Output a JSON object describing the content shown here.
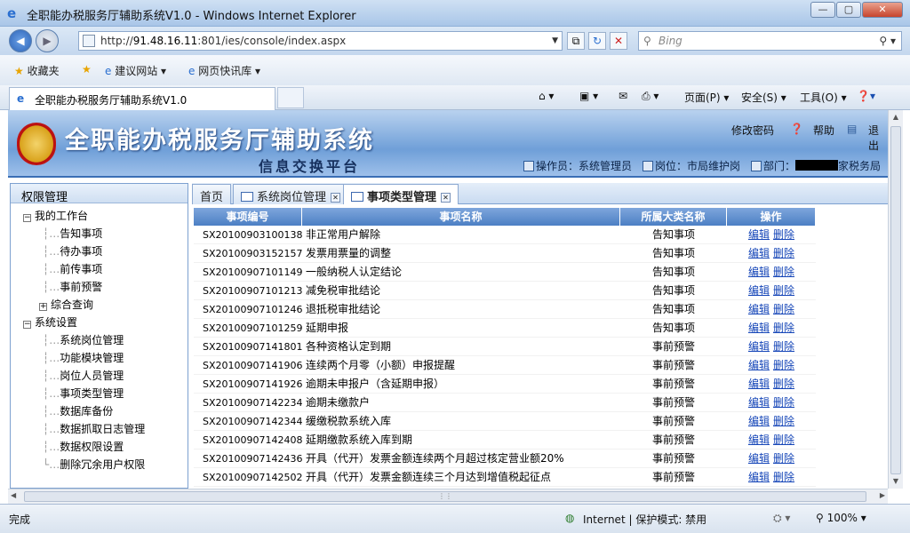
{
  "window": {
    "title": "全职能办税服务厅辅助系统V1.0 - Windows Internet Explorer",
    "controls": [
      "—",
      "▢",
      "✕"
    ]
  },
  "browser": {
    "address": {
      "prefix": "http://",
      "host": "91.48.16.11",
      "rest": ":801/ies/console/index.aspx"
    },
    "search_placeholder": "Bing",
    "favorites_label": "收藏夹",
    "fav_links": [
      "建议网站 ▾",
      "网页快讯库 ▾"
    ],
    "tab_title": "全职能办税服务厅辅助系统V1.0",
    "commands": [
      "页面(P) ▾",
      "安全(S) ▾",
      "工具(O) ▾"
    ],
    "status_left": "完成",
    "status_zone": "Internet | 保护模式: 禁用",
    "zoom": "100%"
  },
  "app": {
    "title": "全职能办税服务厅辅助系统",
    "subtitle": "信息交换平台",
    "top_links": {
      "change_password": "修改密码",
      "help": "帮助",
      "logout": "退出"
    },
    "user": {
      "operator": "操作员：系统管理员",
      "position": "岗位：市局维护岗",
      "dept_prefix": "部门：",
      "dept_suffix": "家税务局"
    }
  },
  "sidebar": {
    "header": "权限管理",
    "groups": [
      {
        "label": "我的工作台",
        "toggle": "−",
        "items": [
          "告知事项",
          "待办事项",
          "前传事项",
          "事前预警"
        ],
        "sub": {
          "label": "综合查询",
          "toggle": "+"
        }
      },
      {
        "label": "系统设置",
        "toggle": "−",
        "items": [
          "系统岗位管理",
          "功能模块管理",
          "岗位人员管理",
          "事项类型管理",
          "数据库备份",
          "数据抓取日志管理",
          "数据权限设置",
          "删除冗余用户权限"
        ]
      }
    ]
  },
  "tabs": {
    "home": "首页",
    "t1": "系统岗位管理",
    "t2": "事项类型管理"
  },
  "table": {
    "headers": [
      "事项编号",
      "事项名称",
      "所属大类名称",
      "操作"
    ],
    "edit_label": "编辑",
    "delete_label": "删除",
    "rows": [
      [
        "SX20100903100138",
        "非正常用户解除",
        "告知事项"
      ],
      [
        "SX20100903152157",
        "发票用票量的调整",
        "告知事项"
      ],
      [
        "SX20100907101149",
        "一般纳税人认定结论",
        "告知事项"
      ],
      [
        "SX20100907101213",
        "减免税审批结论",
        "告知事项"
      ],
      [
        "SX20100907101246",
        "退抵税审批结论",
        "告知事项"
      ],
      [
        "SX20100907101259",
        "延期申报",
        "告知事项"
      ],
      [
        "SX20100907141801",
        "各种资格认定到期",
        "事前预警"
      ],
      [
        "SX20100907141906",
        "连续两个月零（小额）申报提醒",
        "事前预警"
      ],
      [
        "SX20100907141926",
        "逾期未申报户（含延期申报）",
        "事前预警"
      ],
      [
        "SX20100907142234",
        "逾期未缴款户",
        "事前预警"
      ],
      [
        "SX20100907142344",
        "缓缴税款系统入库",
        "事前预警"
      ],
      [
        "SX20100907142408",
        "延期缴款系统入库到期",
        "事前预警"
      ],
      [
        "SX20100907142436",
        "开具（代开）发票金额连续两个月超过核定营业额20%",
        "事前预警"
      ],
      [
        "SX20100907142502",
        "开具（代开）发票金额连续三个月达到增值税起征点",
        "事前预警"
      ]
    ]
  },
  "colors": {
    "banner": "#6f9fd8",
    "grid_header": "#4c7fc4",
    "link": "#1646b8"
  }
}
